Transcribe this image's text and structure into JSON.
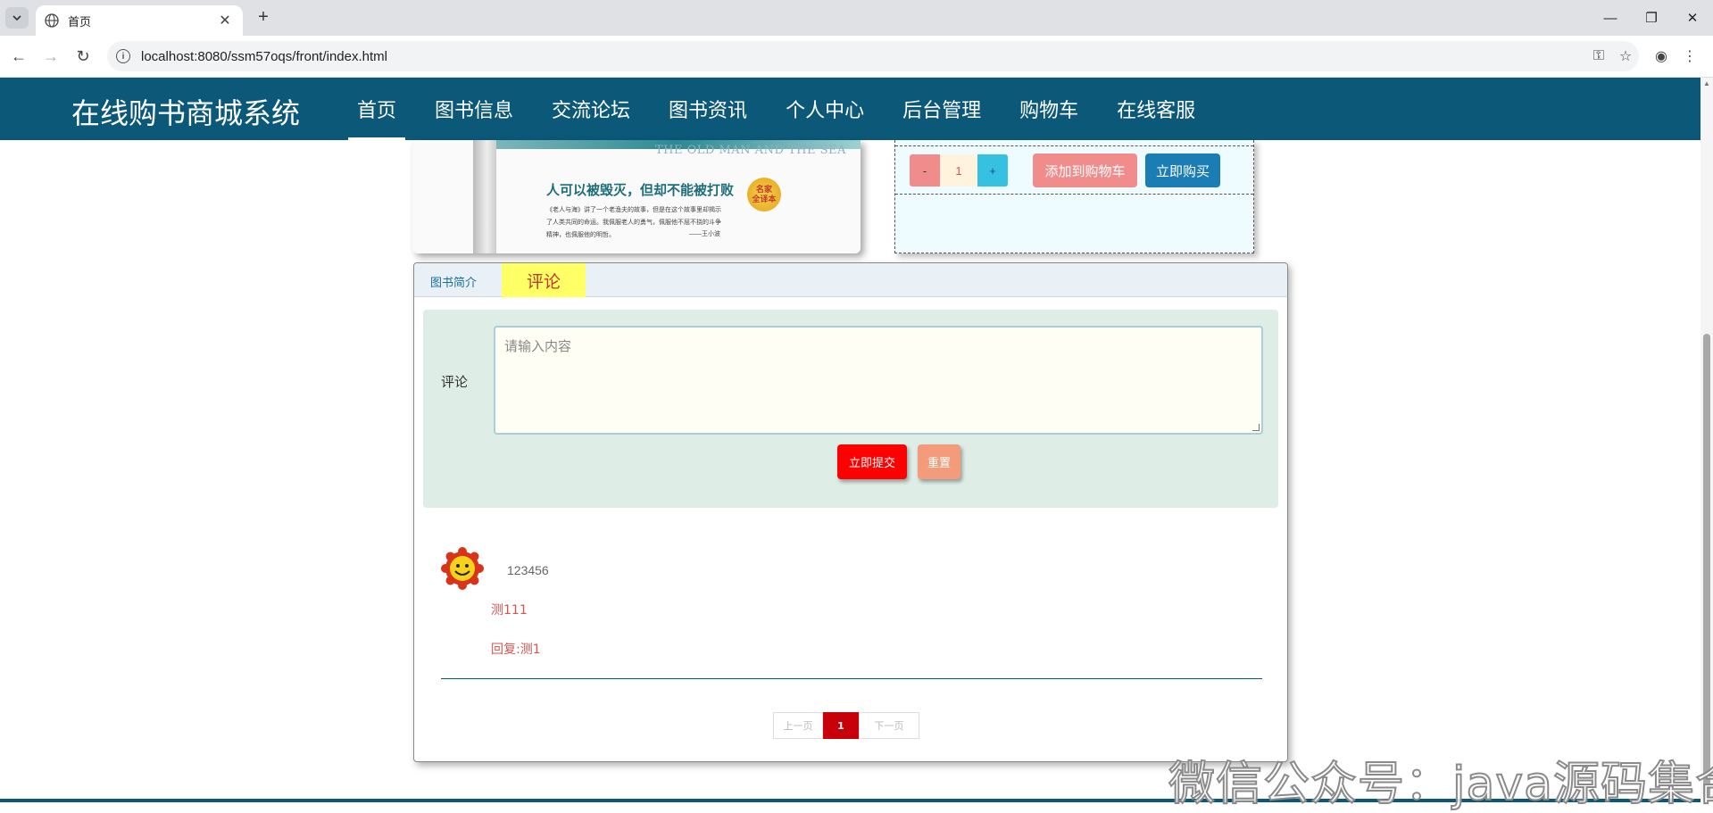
{
  "browser": {
    "tab_title": "首页",
    "url": "localhost:8080/ssm57oqs/front/index.html"
  },
  "header": {
    "site_title": "在线购书商城系统",
    "nav": [
      "首页",
      "图书信息",
      "交流论坛",
      "图书资讯",
      "个人中心",
      "后台管理",
      "购物车",
      "在线客服"
    ],
    "active_nav": "首页"
  },
  "book_image": {
    "english_title": "THE OLD MAN AND THE SEA",
    "slogan": "人可以被毁灭，但却不能被打败",
    "seal_line1": "名家",
    "seal_line2": "全译本",
    "blurb": "《老人与海》讲了一个老渔夫的故事，但是在这个故事里却揭示了人类共同的命运。我佩服老人的勇气，佩服他不屈不挠的斗争精神，也佩服他的明哲。",
    "author": "——王小波"
  },
  "purchase": {
    "minus": "-",
    "quantity": "1",
    "plus": "+",
    "add_to_cart": "添加到购物车",
    "buy_now": "立即购买"
  },
  "tabs": {
    "intro": "图书简介",
    "comment": "评论"
  },
  "comment_form": {
    "label": "评论",
    "placeholder": "请输入内容",
    "submit": "立即提交",
    "reset": "重置"
  },
  "comments": [
    {
      "user": "123456",
      "content": "测111",
      "reply": "回复:测1"
    }
  ],
  "pagination": {
    "prev": "上一页",
    "current": "1",
    "next": "下一页"
  },
  "watermark": "微信公众号：java源码集合",
  "colors": {
    "brand": "#0b5879",
    "add_cart": "#f08c8c",
    "buy_now": "#1a7db4",
    "submit": "#ff0000",
    "reset": "#f39b7a",
    "comment_tab": "#ffff66",
    "page_current": "#c8000a"
  }
}
